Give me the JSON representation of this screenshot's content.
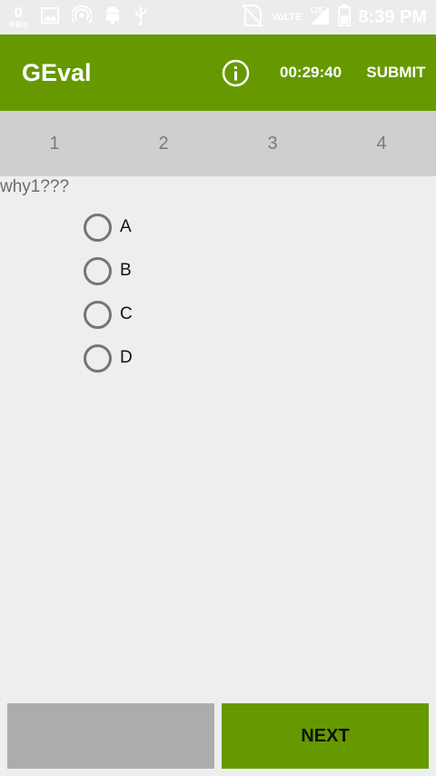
{
  "status_bar": {
    "net_speed_value": "0",
    "net_speed_unit": "KB/s",
    "network_label": "VoLTE",
    "lte_label": "LTE",
    "time": "8:39 PM",
    "icons": [
      "image-icon",
      "hotspot-icon",
      "android-debug-icon",
      "usb-icon",
      "no-sim-icon",
      "signal-icon",
      "battery-icon"
    ]
  },
  "app_bar": {
    "title": "GEval",
    "timer": "00:29:40",
    "submit_label": "SUBMIT",
    "color": "#669900"
  },
  "question_tabs": [
    "1",
    "2",
    "3",
    "4"
  ],
  "question": {
    "text": "why1???",
    "options": [
      "A",
      "B",
      "C",
      "D"
    ]
  },
  "footer": {
    "prev_label": "",
    "next_label": "NEXT"
  }
}
